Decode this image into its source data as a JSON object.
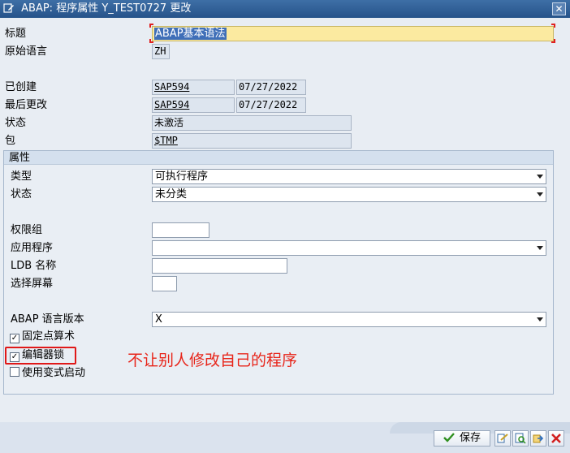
{
  "window": {
    "title": "ABAP: 程序属性 Y_TEST0727 更改",
    "close_label": "✕"
  },
  "header_fields": {
    "title_label": "标题",
    "title_value": "ABAP基本语法",
    "orig_lang_label": "原始语言",
    "orig_lang_value": "ZH",
    "created_label": "已创建",
    "created_user": "SAP594",
    "created_date": "07/27/2022",
    "changed_label": "最后更改",
    "changed_user": "SAP594",
    "changed_date": "07/27/2022",
    "status_label": "状态",
    "status_value": "未激活",
    "package_label": "包",
    "package_value": "$TMP"
  },
  "attributes": {
    "header": "属性",
    "type_label": "类型",
    "type_value": "可执行程序",
    "status_label": "状态",
    "status_value": "未分类",
    "auth_group_label": "权限组",
    "auth_group_value": "",
    "application_label": "应用程序",
    "application_value": "",
    "ldb_label": "LDB 名称",
    "ldb_value": "",
    "selscreen_label": "选择屏幕",
    "selscreen_value": "",
    "abap_version_label": "ABAP 语言版本",
    "abap_version_value": "X",
    "fixed_point_label": "固定点算术",
    "fixed_point_checked": true,
    "editor_lock_label": "编辑器锁",
    "editor_lock_checked": true,
    "variant_start_label": "使用变式启动",
    "variant_start_checked": false
  },
  "annotation": {
    "text": "不让别人修改自己的程序",
    "color": "#e8251a"
  },
  "footer": {
    "save_label": "保存"
  },
  "colors": {
    "titlebar": "#26538a",
    "title_field_bg": "#fbeaa0",
    "highlight": "#e01818"
  }
}
